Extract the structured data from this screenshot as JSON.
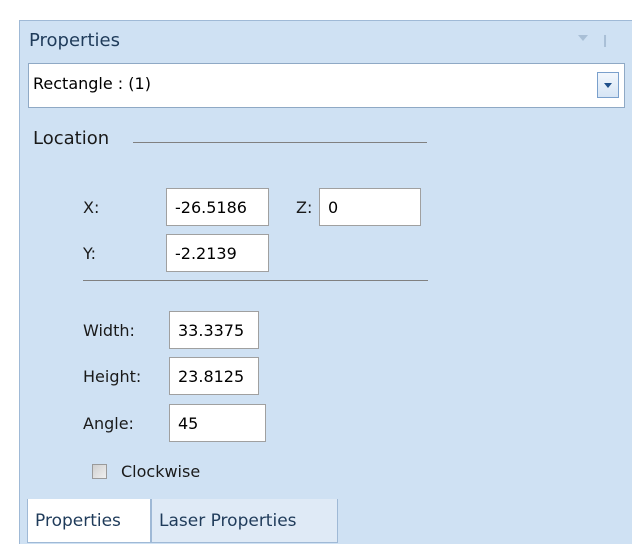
{
  "panel": {
    "title": "Properties",
    "pin_icon": "pin-icon",
    "menu_icon": "dropdown-arrow-icon"
  },
  "selector": {
    "value": "Rectangle : (1)",
    "icon": "chevron-down-icon"
  },
  "location": {
    "title": "Location",
    "x_label": "X:",
    "x_value": "-26.5186",
    "z_label": "Z:",
    "z_value": "0",
    "y_label": "Y:",
    "y_value": "-2.2139"
  },
  "size": {
    "width_label": "Width:",
    "width_value": "33.3375",
    "height_label": "Height:",
    "height_value": "23.8125",
    "angle_label": "Angle:",
    "angle_value": "45",
    "clockwise_label": "Clockwise",
    "clockwise_checked": false
  },
  "tabs": [
    {
      "label": "Properties",
      "active": true
    },
    {
      "label": "Laser Properties",
      "active": false
    }
  ],
  "colors": {
    "panel_bg": "#cfe1f3",
    "title_text": "#1f3b5a",
    "border": "#9fb9d6"
  }
}
